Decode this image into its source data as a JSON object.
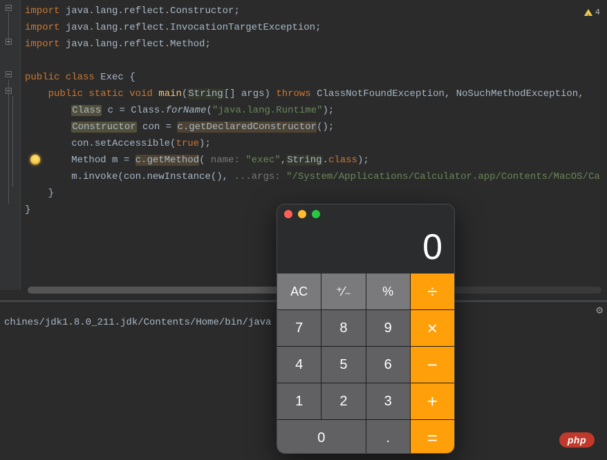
{
  "editor": {
    "warning_count": "4",
    "lines": {
      "l1": {
        "kw": "import",
        "rest": " java.lang.reflect.Constructor;"
      },
      "l2": {
        "kw": "import",
        "rest": " java.lang.reflect.InvocationTargetException;"
      },
      "l3": {
        "kw": "import",
        "rest": " java.lang.reflect.Method;"
      },
      "l5a": "public class ",
      "l5b": "Exec",
      "l5c": " {",
      "l6a": "    ",
      "l6b": "public static void ",
      "l6c": "main",
      "l6d": "(",
      "l6e": "String",
      "l6f": "[] args) ",
      "l6g": "throws ",
      "l6h": "ClassNotFoundException, NoSuchMethodException,",
      "l7a": "        ",
      "l7b": "Class",
      "l7c": " c = Class.",
      "l7d": "forName",
      "l7e": "(",
      "l7f": "\"java.lang.Runtime\"",
      "l7g": ");",
      "l8a": "        ",
      "l8b": "Constructor",
      "l8c": " con = ",
      "l8d": "c.getDeclaredConstructor",
      "l8e": "();",
      "l9a": "        con.setAccessible(",
      "l9b": "true",
      "l9c": ");",
      "l10a": "        Method m = ",
      "l10b": "c.getMethod",
      "l10c": "(",
      "l10d": " name: ",
      "l10e": "\"exec\"",
      "l10f": ",",
      "l10g": "String",
      "l10h": ".",
      "l10i": "class",
      "l10j": ");",
      "l11a": "        m.invoke(con.newInstance(), ",
      "l11b": "...args: ",
      "l11c": "\"/System/Applications/Calculator.app/Contents/MacOS/Ca",
      "l12": "    }",
      "l13": "}"
    }
  },
  "console": {
    "line1": "chines/jdk1.8.0_211.jdk/Contents/Home/bin/java"
  },
  "calc": {
    "display": "0",
    "buttons": {
      "ac": "AC",
      "sign": "⁺⁄₋",
      "pct": "%",
      "div": "÷",
      "b7": "7",
      "b8": "8",
      "b9": "9",
      "mul": "×",
      "b4": "4",
      "b5": "5",
      "b6": "6",
      "sub": "−",
      "b1": "1",
      "b2": "2",
      "b3": "3",
      "add": "+",
      "b0": "0",
      "dot": ".",
      "eq": "="
    }
  },
  "badge": {
    "php": "php"
  }
}
